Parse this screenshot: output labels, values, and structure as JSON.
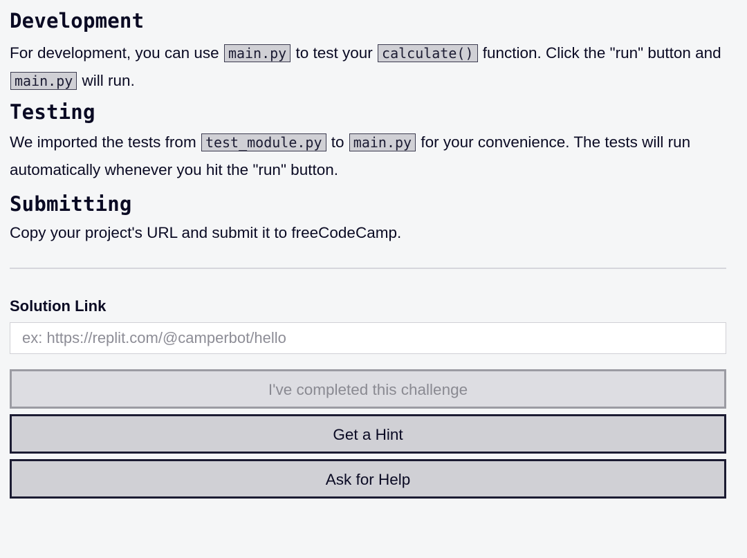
{
  "development": {
    "heading": "Development",
    "t1": "For development, you can use ",
    "code1": "main.py",
    "t2": " to test your ",
    "code2": "calculate()",
    "t3": " function. Click the \"run\" button and ",
    "code3": "main.py",
    "t4": " will run."
  },
  "testing": {
    "heading": "Testing",
    "t1": "We imported the tests from ",
    "code1": "test_module.py",
    "t2": " to ",
    "code2": "main.py",
    "t3": " for your convenience. The tests will run automatically whenever you hit the \"run\" button."
  },
  "submitting": {
    "heading": "Submitting",
    "text": "Copy your project's URL and submit it to freeCodeCamp."
  },
  "form": {
    "label": "Solution Link",
    "value": "",
    "placeholder": "ex: https://replit.com/@camperbot/hello"
  },
  "buttons": {
    "complete": "I've completed this challenge",
    "hint": "Get a Hint",
    "help": "Ask for Help"
  },
  "colors": {
    "background": "#f5f6f7",
    "code_bg": "#d0d0d5",
    "button_bg": "#d0d0d5",
    "button_border": "#1b1b32",
    "disabled_text": "#8a8a92"
  }
}
